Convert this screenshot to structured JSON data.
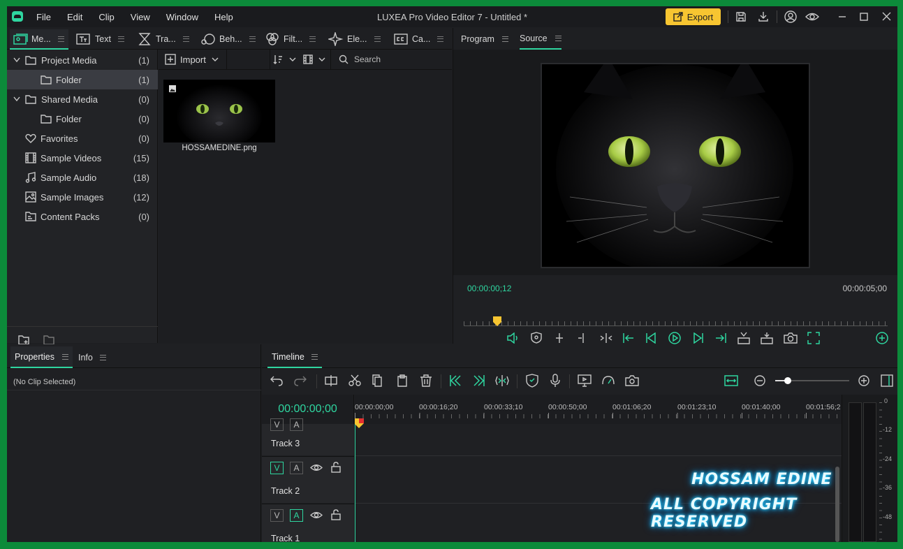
{
  "app": {
    "title": "LUXEA Pro Video Editor 7 - Untitled *",
    "menu": [
      "File",
      "Edit",
      "Clip",
      "View",
      "Window",
      "Help"
    ],
    "export_label": "Export"
  },
  "media_tabs": [
    "Me...",
    "Text",
    "Tra...",
    "Beh...",
    "Filt...",
    "Ele...",
    "Ca..."
  ],
  "tree": [
    {
      "label": "Project Media",
      "count": "(1)"
    },
    {
      "label": "Folder",
      "count": "(1)"
    },
    {
      "label": "Shared Media",
      "count": "(0)"
    },
    {
      "label": "Folder",
      "count": "(0)"
    },
    {
      "label": "Favorites",
      "count": "(0)"
    },
    {
      "label": "Sample Videos",
      "count": "(15)"
    },
    {
      "label": "Sample Audio",
      "count": "(18)"
    },
    {
      "label": "Sample Images",
      "count": "(12)"
    },
    {
      "label": "Content Packs",
      "count": "(0)"
    }
  ],
  "grid": {
    "import_label": "Import",
    "search_placeholder": "Search",
    "file_name": "HOSSAMEDINE.png"
  },
  "viewer": {
    "tabs": [
      "Program",
      "Source"
    ],
    "current_time": "00:00:00;12",
    "duration": "00:00:05;00"
  },
  "properties": {
    "tabs": [
      "Properties",
      "Info"
    ],
    "empty_text": "(No Clip Selected)"
  },
  "timeline": {
    "tab": "Timeline",
    "timecode": "00:00:00;00",
    "ruler": [
      "00:00:00;00",
      "00:00:16;20",
      "00:00:33;10",
      "00:00:50;00",
      "00:01:06;20",
      "00:01:23;10",
      "00:01:40;00",
      "00:01:56;2"
    ],
    "tracks": [
      "Track 3",
      "Track 2",
      "Track 1"
    ],
    "track_v": "V",
    "track_a": "A",
    "meter_scale": [
      "0",
      "-12",
      "-24",
      "-36",
      "-48"
    ]
  },
  "watermark": {
    "line1": "HOSSAM EDINE",
    "line2": "ALL COPYRIGHT RESERVED"
  },
  "colors": {
    "accent": "#2fd6a0",
    "export": "#f7c531",
    "frame": "#0c8a3a"
  }
}
